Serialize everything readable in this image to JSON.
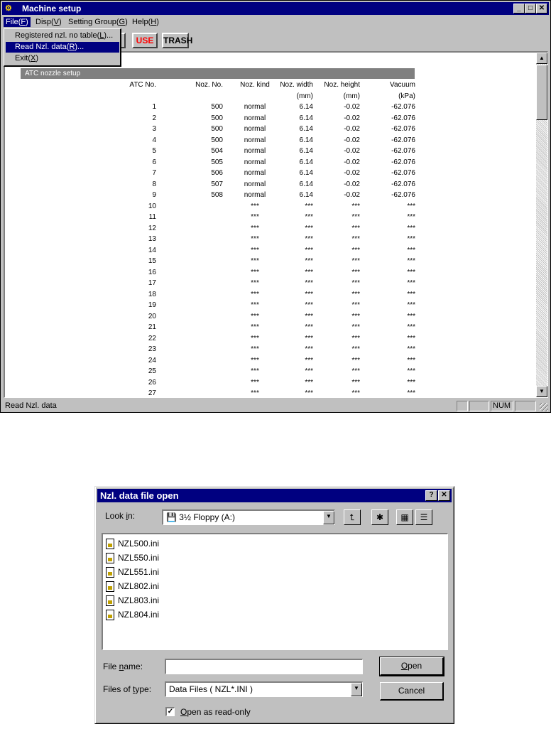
{
  "main": {
    "title": "Machine setup",
    "menu": [
      {
        "pre": "File(",
        "key": "F",
        "post": ")"
      },
      {
        "pre": "Disp(",
        "key": "V",
        "post": ")"
      },
      {
        "pre": "Setting Group(",
        "key": "G",
        "post": ")"
      },
      {
        "pre": "Help(",
        "key": "H",
        "post": ")"
      }
    ],
    "file_menu": [
      {
        "pre": "Registered nzl. no table(",
        "key": "L",
        "post": ")..."
      },
      {
        "pre": "Read Nzl. data(",
        "key": "R",
        "post": ")..."
      },
      {
        "pre": "Exit(",
        "key": "X",
        "post": ")"
      }
    ],
    "toolbar": {
      "use": "USE",
      "trash": "TRASH"
    },
    "section": "ATC nozzle setup",
    "headers": {
      "atc": "ATC No.",
      "noz": "Noz. No.",
      "kind": "Noz. kind",
      "width": "Noz. width",
      "height": "Noz. height",
      "vacuum": "Vacuum",
      "width_unit": "(mm)",
      "height_unit": "(mm)",
      "vacuum_unit": "(kPa)"
    },
    "rows": [
      {
        "atc": "1",
        "noz": "500",
        "kind": "normal",
        "width": "6.14",
        "height": "-0.02",
        "vacuum": "-62.076"
      },
      {
        "atc": "2",
        "noz": "500",
        "kind": "normal",
        "width": "6.14",
        "height": "-0.02",
        "vacuum": "-62.076"
      },
      {
        "atc": "3",
        "noz": "500",
        "kind": "normal",
        "width": "6.14",
        "height": "-0.02",
        "vacuum": "-62.076"
      },
      {
        "atc": "4",
        "noz": "500",
        "kind": "normal",
        "width": "6.14",
        "height": "-0.02",
        "vacuum": "-62.076"
      },
      {
        "atc": "5",
        "noz": "504",
        "kind": "normal",
        "width": "6.14",
        "height": "-0.02",
        "vacuum": "-62.076"
      },
      {
        "atc": "6",
        "noz": "505",
        "kind": "normal",
        "width": "6.14",
        "height": "-0.02",
        "vacuum": "-62.076"
      },
      {
        "atc": "7",
        "noz": "506",
        "kind": "normal",
        "width": "6.14",
        "height": "-0.02",
        "vacuum": "-62.076"
      },
      {
        "atc": "8",
        "noz": "507",
        "kind": "normal",
        "width": "6.14",
        "height": "-0.02",
        "vacuum": "-62.076"
      },
      {
        "atc": "9",
        "noz": "508",
        "kind": "normal",
        "width": "6.14",
        "height": "-0.02",
        "vacuum": "-62.076"
      },
      {
        "atc": "10",
        "noz": "",
        "kind": "***",
        "width": "***",
        "height": "***",
        "vacuum": "***"
      },
      {
        "atc": "11",
        "noz": "",
        "kind": "***",
        "width": "***",
        "height": "***",
        "vacuum": "***"
      },
      {
        "atc": "12",
        "noz": "",
        "kind": "***",
        "width": "***",
        "height": "***",
        "vacuum": "***"
      },
      {
        "atc": "13",
        "noz": "",
        "kind": "***",
        "width": "***",
        "height": "***",
        "vacuum": "***"
      },
      {
        "atc": "14",
        "noz": "",
        "kind": "***",
        "width": "***",
        "height": "***",
        "vacuum": "***"
      },
      {
        "atc": "15",
        "noz": "",
        "kind": "***",
        "width": "***",
        "height": "***",
        "vacuum": "***"
      },
      {
        "atc": "16",
        "noz": "",
        "kind": "***",
        "width": "***",
        "height": "***",
        "vacuum": "***"
      },
      {
        "atc": "17",
        "noz": "",
        "kind": "***",
        "width": "***",
        "height": "***",
        "vacuum": "***"
      },
      {
        "atc": "18",
        "noz": "",
        "kind": "***",
        "width": "***",
        "height": "***",
        "vacuum": "***"
      },
      {
        "atc": "19",
        "noz": "",
        "kind": "***",
        "width": "***",
        "height": "***",
        "vacuum": "***"
      },
      {
        "atc": "20",
        "noz": "",
        "kind": "***",
        "width": "***",
        "height": "***",
        "vacuum": "***"
      },
      {
        "atc": "21",
        "noz": "",
        "kind": "***",
        "width": "***",
        "height": "***",
        "vacuum": "***"
      },
      {
        "atc": "22",
        "noz": "",
        "kind": "***",
        "width": "***",
        "height": "***",
        "vacuum": "***"
      },
      {
        "atc": "23",
        "noz": "",
        "kind": "***",
        "width": "***",
        "height": "***",
        "vacuum": "***"
      },
      {
        "atc": "24",
        "noz": "",
        "kind": "***",
        "width": "***",
        "height": "***",
        "vacuum": "***"
      },
      {
        "atc": "25",
        "noz": "",
        "kind": "***",
        "width": "***",
        "height": "***",
        "vacuum": "***"
      },
      {
        "atc": "26",
        "noz": "",
        "kind": "***",
        "width": "***",
        "height": "***",
        "vacuum": "***"
      },
      {
        "atc": "27",
        "noz": "",
        "kind": "***",
        "width": "***",
        "height": "***",
        "vacuum": "***"
      }
    ],
    "status_text": "Read Nzl. data",
    "status_num": "NUM"
  },
  "dialog": {
    "title": "Nzl. data file open",
    "look_in": {
      "pre": "Look ",
      "key": "i",
      "post": "n:"
    },
    "look_in_value": "3½ Floppy (A:)",
    "files": [
      "NZL500.ini",
      "NZL550.ini",
      "NZL551.ini",
      "NZL802.ini",
      "NZL803.ini",
      "NZL804.ini"
    ],
    "file_name": {
      "pre": "File ",
      "key": "n",
      "post": "ame:"
    },
    "file_name_value": "",
    "file_type": {
      "pre": "Files of ",
      "key": "t",
      "post": "ype:"
    },
    "file_type_value": "Data Files ( NZL*.INI )",
    "open": {
      "pre": "",
      "key": "O",
      "post": "pen"
    },
    "cancel": "Cancel",
    "readonly": {
      "pre": "",
      "key": "O",
      "post": "pen as read-only"
    },
    "readonly_checked": true
  },
  "colors": {
    "titlebar": "#000080",
    "face": "#c0c0c0",
    "section": "#808080",
    "use_text": "#ff0000"
  }
}
